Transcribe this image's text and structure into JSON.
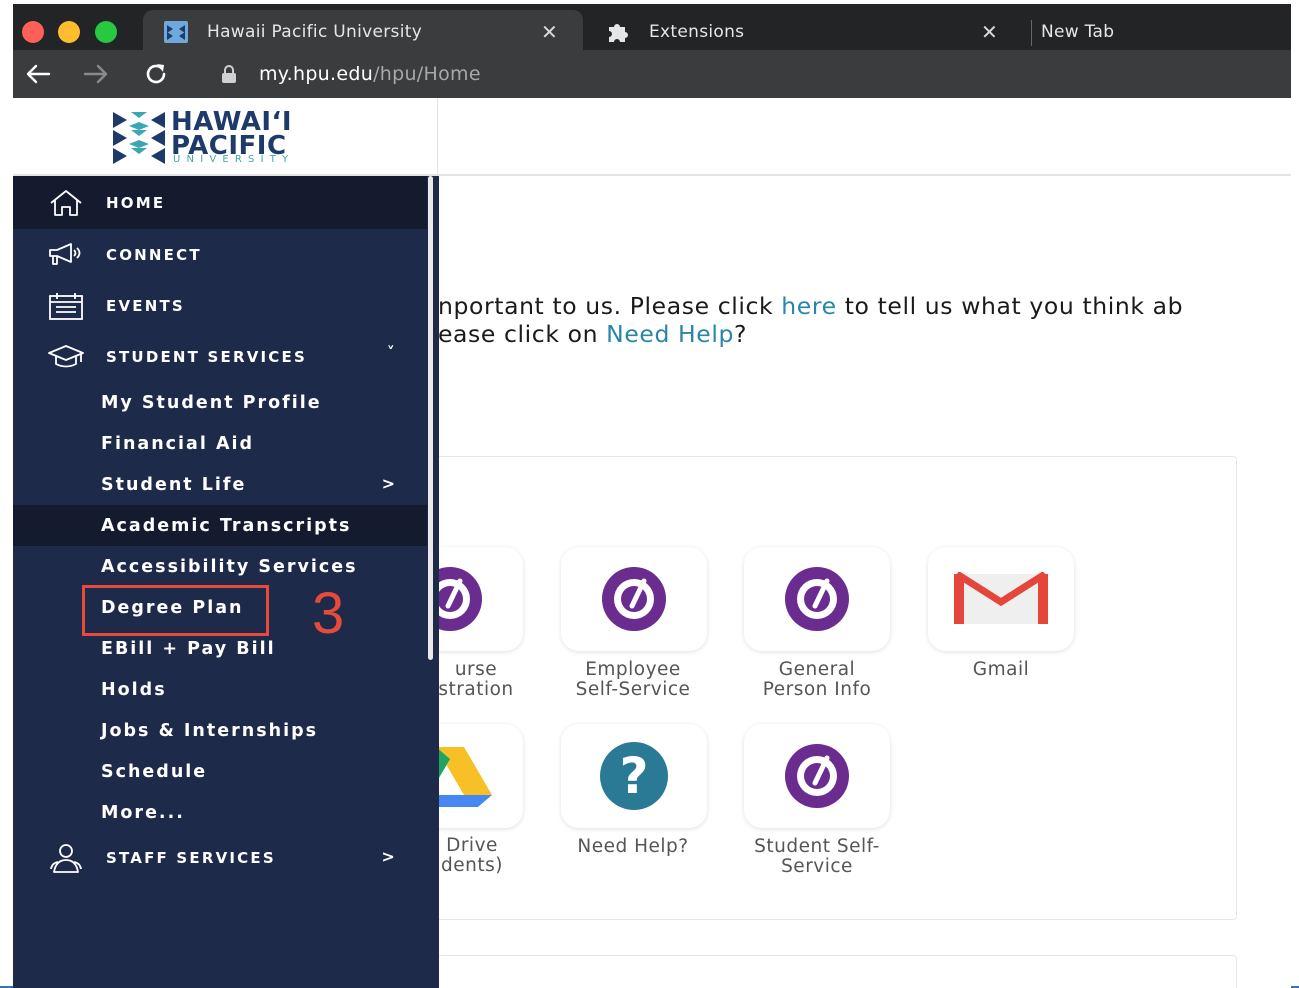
{
  "browser": {
    "tabs": [
      {
        "title": "Hawaii Pacific University",
        "icon": "hpu-favicon"
      },
      {
        "title": "Extensions",
        "icon": "puzzle-icon"
      },
      {
        "title": "New Tab"
      }
    ],
    "url_host": "my.hpu.edu",
    "url_path": "/hpu/Home"
  },
  "logo": {
    "line1": "HAWAI‘I",
    "line2": "PACIFIC",
    "line3": "UNIVERSITY"
  },
  "sidebar": {
    "items": [
      {
        "label": "HOME",
        "icon": "home-icon"
      },
      {
        "label": "CONNECT",
        "icon": "megaphone-icon"
      },
      {
        "label": "EVENTS",
        "icon": "calendar-icon"
      },
      {
        "label": "STUDENT SERVICES",
        "icon": "graduation-cap-icon",
        "chevron": "˅"
      }
    ],
    "sub_items": [
      "My Student Profile",
      "Financial Aid",
      "Student Life",
      "Academic Transcripts",
      "Accessibility Services",
      "Degree Plan",
      "EBill + Pay Bill",
      "Holds",
      "Jobs & Internships",
      "Schedule",
      "More..."
    ],
    "student_life_chevron": ">",
    "staff": {
      "label": "STAFF SERVICES",
      "icon": "people-icon",
      "chevron": ">"
    }
  },
  "annotation": {
    "step": "3"
  },
  "notice": {
    "line1_pre": "nportant to us. Please click ",
    "line1_link": "here",
    "line1_post": " to tell us what you think ab",
    "line2_pre": "ease click on ",
    "line2_link": "Need Help",
    "line2_post": "?"
  },
  "tiles": [
    {
      "label1": "urse",
      "label2": "stration",
      "icon": "ellucian-icon"
    },
    {
      "label1": "Employee",
      "label2": "Self-Service",
      "icon": "ellucian-icon"
    },
    {
      "label1": "General",
      "label2": "Person Info",
      "icon": "ellucian-icon"
    },
    {
      "label1": "Gmail",
      "label2": "",
      "icon": "gmail-icon"
    },
    {
      "label1": "Drive",
      "label2": "dents)",
      "icon": "google-drive-icon"
    },
    {
      "label1": "Need Help?",
      "label2": "",
      "icon": "help-icon"
    },
    {
      "label1": "Student Self-",
      "label2": "Service",
      "icon": "ellucian-icon"
    }
  ],
  "colors": {
    "sidebar_bg": "#1e2a4a",
    "sidebar_active": "#141b2e",
    "link": "#2a86a6",
    "annotation": "#e64a3a",
    "ellucian_purple": "#6a2c8e",
    "help_teal": "#2a7a96"
  }
}
